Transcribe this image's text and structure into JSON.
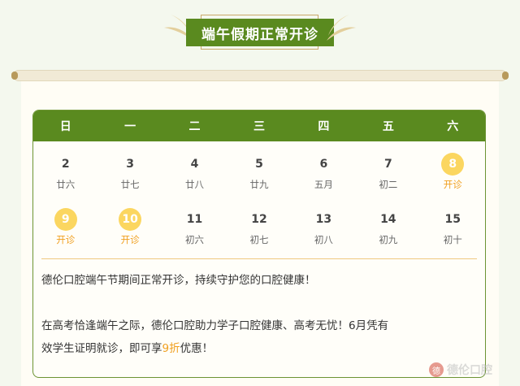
{
  "banner": {
    "title": "端午假期正常开诊"
  },
  "calendar": {
    "weekdays": [
      "日",
      "一",
      "二",
      "三",
      "四",
      "五",
      "六"
    ],
    "weeks": [
      [
        {
          "day": "2",
          "label": "廿六",
          "open": false
        },
        {
          "day": "3",
          "label": "廿七",
          "open": false
        },
        {
          "day": "4",
          "label": "廿八",
          "open": false
        },
        {
          "day": "5",
          "label": "廿九",
          "open": false
        },
        {
          "day": "6",
          "label": "五月",
          "open": false
        },
        {
          "day": "7",
          "label": "初二",
          "open": false
        },
        {
          "day": "8",
          "label": "开诊",
          "open": true
        }
      ],
      [
        {
          "day": "9",
          "label": "开诊",
          "open": true
        },
        {
          "day": "10",
          "label": "开诊",
          "open": true
        },
        {
          "day": "11",
          "label": "初六",
          "open": false
        },
        {
          "day": "12",
          "label": "初七",
          "open": false
        },
        {
          "day": "13",
          "label": "初八",
          "open": false
        },
        {
          "day": "14",
          "label": "初九",
          "open": false
        },
        {
          "day": "15",
          "label": "初十",
          "open": false
        }
      ]
    ]
  },
  "notes": {
    "line1": "德伦口腔端午节期间正常开诊，持续守护您的口腔健康！",
    "line2": "在高考恰逢端午之际，德伦口腔助力学子口腔健康、高考无忧！6月凭有",
    "line3_pre": "效学生证明就诊，即可享",
    "line3_accent": "9折",
    "line3_post": "优惠！"
  },
  "watermark": {
    "text": "德伦口腔",
    "logo": "德"
  },
  "colors": {
    "green": "#5a8a1f",
    "highlight": "#fbd660",
    "accent": "#f0a020"
  }
}
